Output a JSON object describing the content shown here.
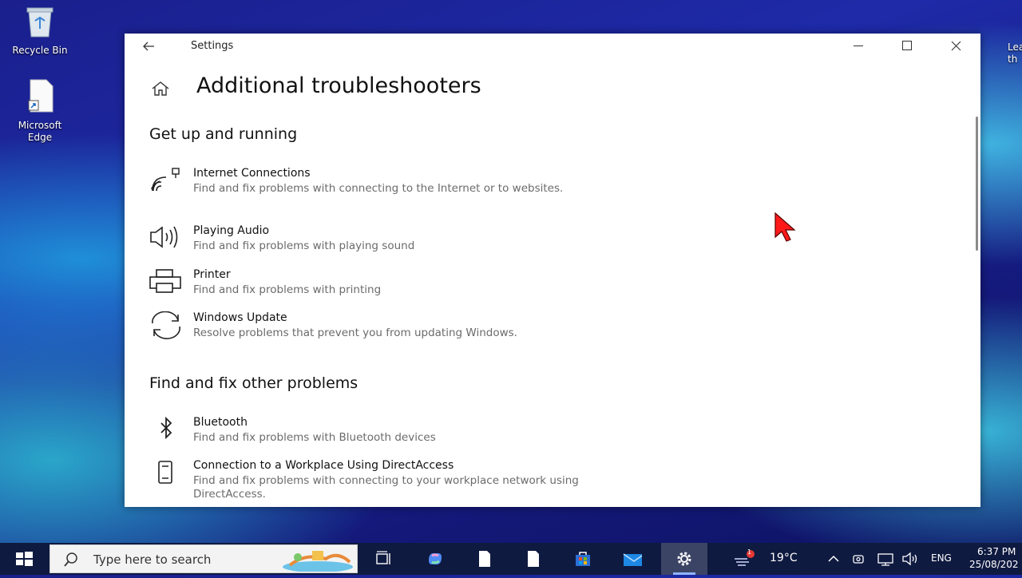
{
  "desktop": {
    "icons": [
      {
        "label": "Recycle Bin"
      },
      {
        "label": "Microsoft Edge"
      }
    ],
    "right_partial_text": "Lea th"
  },
  "window": {
    "app_title": "Settings",
    "page_title": "Additional troubleshooters",
    "sections": [
      {
        "heading": "Get up and running",
        "items": [
          {
            "icon": "network-icon",
            "title": "Internet Connections",
            "description": "Find and fix problems with connecting to the Internet or to websites."
          },
          {
            "icon": "speaker-icon",
            "title": "Playing Audio",
            "description": "Find and fix problems with playing sound"
          },
          {
            "icon": "printer-icon",
            "title": "Printer",
            "description": "Find and fix problems with printing"
          },
          {
            "icon": "sync-icon",
            "title": "Windows Update",
            "description": "Resolve problems that prevent you from updating Windows."
          }
        ]
      },
      {
        "heading": "Find and fix other problems",
        "items": [
          {
            "icon": "bluetooth-icon",
            "title": "Bluetooth",
            "description": "Find and fix problems with Bluetooth devices"
          },
          {
            "icon": "phone-icon",
            "title": "Connection to a Workplace Using DirectAccess",
            "description": "Find and fix problems with connecting to your workplace network using DirectAccess."
          }
        ]
      }
    ]
  },
  "taskbar": {
    "search_placeholder": "Type here to search",
    "weather": {
      "temp": "19°C",
      "badge": "1"
    },
    "language": "ENG",
    "time": "6:37 PM",
    "date": "25/08/202"
  },
  "colors": {
    "accent": "#8fb4ff",
    "taskbar_bg": "#0f1a40",
    "cursor": "#ff1a1a"
  }
}
